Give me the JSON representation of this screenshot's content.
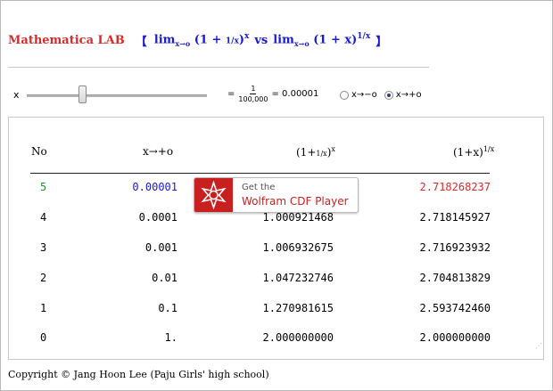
{
  "title": {
    "lab": "Mathematica LAB",
    "open_bracket": "【",
    "close_bracket": "】",
    "lhs_lim": "lim",
    "lhs_sub": "x→o",
    "lhs_expr": "(1 + ",
    "lhs_frac_num": "1",
    "lhs_frac_den": "x",
    "lhs_close": ")",
    "lhs_exp": "x",
    "vs": "vs",
    "rhs_lim": "lim",
    "rhs_sub": "x→o",
    "rhs_expr": "(1 + x)",
    "rhs_exp_num": "1",
    "rhs_exp_den": "x"
  },
  "controls": {
    "x_label": "x",
    "slider_fraction": 0.3,
    "eq1": "=",
    "frac_num": "1",
    "frac_den": "100,000",
    "eq2": "= 0.00001",
    "radio_minus": "x→−o",
    "radio_plus": "x→+o",
    "selected": "x→+o"
  },
  "table": {
    "headers": {
      "no": "No",
      "x": "x→+o",
      "f1": "(1+",
      "f1_num": "1",
      "f1_den": "x",
      "f1_close": ")",
      "f1_exp": "x",
      "f2": "(1+x)",
      "f2_num": "1",
      "f2_den": "x"
    },
    "rows": [
      {
        "no": "5",
        "x": "0.00001",
        "f1": "",
        "f2": "2.718268237"
      },
      {
        "no": "4",
        "x": "0.0001",
        "f1": "1.000921468",
        "f2": "2.718145927"
      },
      {
        "no": "3",
        "x": "0.001",
        "f1": "1.006932675",
        "f2": "2.716923932"
      },
      {
        "no": "2",
        "x": "0.01",
        "f1": "1.047232746",
        "f2": "2.704813829"
      },
      {
        "no": "1",
        "x": "0.1",
        "f1": "1.270981615",
        "f2": "2.593742460"
      },
      {
        "no": "0",
        "x": "1.",
        "f1": "2.000000000",
        "f2": "2.000000000"
      }
    ],
    "highlight_colors": {
      "no": "#2e8b2e",
      "x": "#1a1acf",
      "f2": "#d62b2b"
    }
  },
  "cdf_banner": {
    "line1": "Get the",
    "line2": "Wolfram CDF Player",
    "icon": "wolfram-spikey-icon"
  },
  "resize_glyph": "⋰",
  "copyright": "Copyright © Jang Hoon Lee (Paju Girls' high school)",
  "colors": {
    "accent_red": "#d62b2b",
    "accent_blue": "#1a1acf",
    "cdf_red": "#c8201f"
  }
}
